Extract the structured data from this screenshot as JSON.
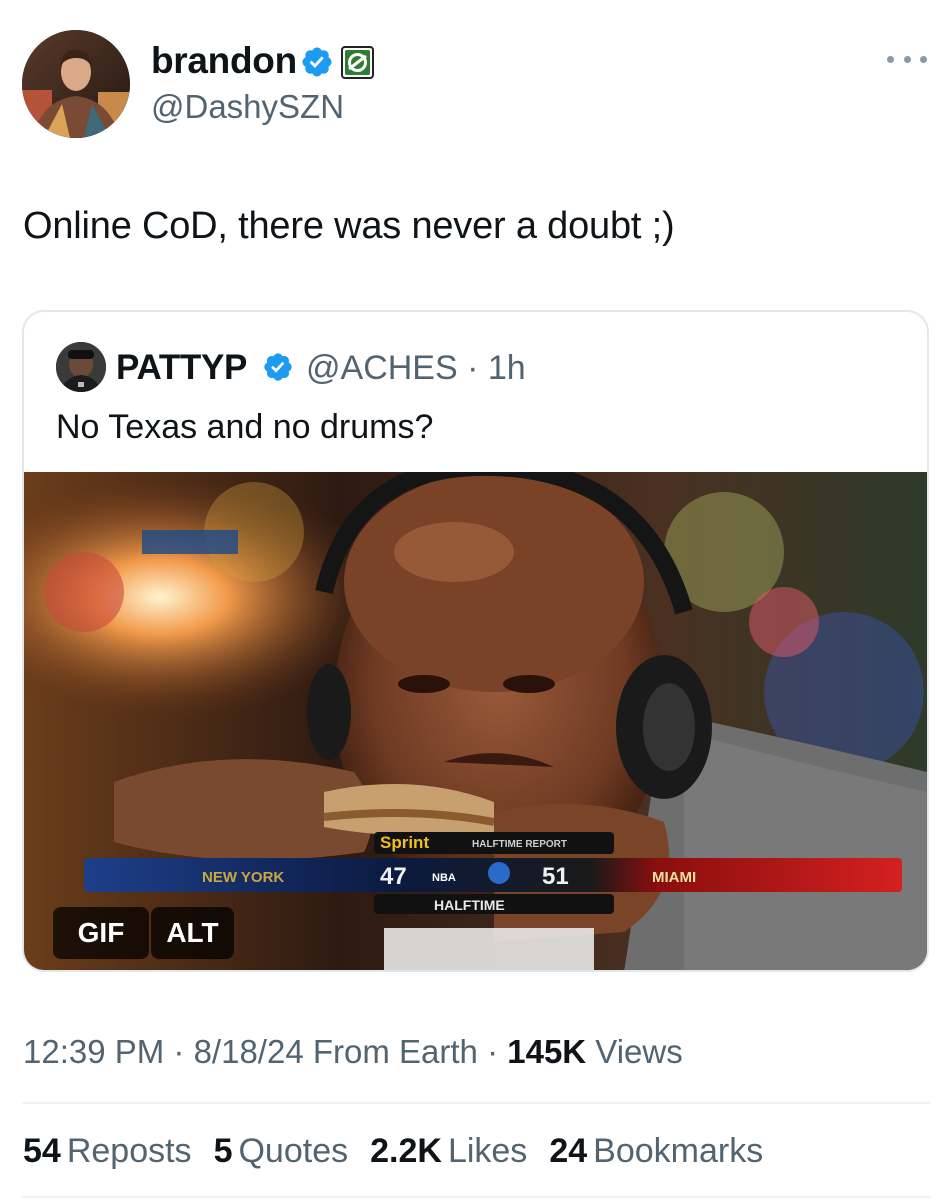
{
  "author": {
    "name": "brandon",
    "handle": "@DashySZN"
  },
  "tweet": {
    "text": "Online CoD, there was never a doubt ;)"
  },
  "quote": {
    "name": "PATTYP",
    "handle": "@ACHES",
    "separator": "·",
    "time": "1h",
    "text": "No Texas and no drums?",
    "media": {
      "badges": {
        "gif": "GIF",
        "alt": "ALT"
      },
      "scoreboard": {
        "sponsor": "Sprint",
        "report": "HALFTIME REPORT",
        "team_left": "NEW YORK",
        "score_left": "47",
        "score_right": "51",
        "team_right": "MIAMI",
        "period": "HALFTIME",
        "network": "NBA"
      }
    }
  },
  "meta": {
    "time": "12:39 PM",
    "date": "8/18/24",
    "source": "From Earth",
    "views_count": "145K",
    "views_label": "Views"
  },
  "stats": {
    "reposts_count": "54",
    "reposts_label": "Reposts",
    "quotes_count": "5",
    "quotes_label": "Quotes",
    "likes_count": "2.2K",
    "likes_label": "Likes",
    "bookmarks_count": "24",
    "bookmarks_label": "Bookmarks"
  },
  "colors": {
    "verified": "#1d9bf0",
    "org_badge": "#2f7d32",
    "secondary_text": "#536471"
  },
  "icons": {
    "verified": "verified-badge-icon",
    "org": "optic-gaming-icon",
    "more": "more-horizontal-icon"
  }
}
